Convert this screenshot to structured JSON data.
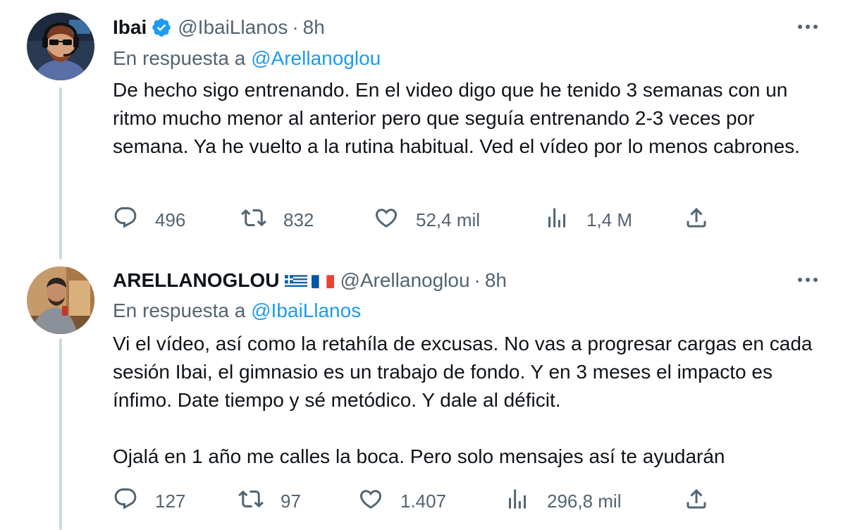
{
  "tweets": [
    {
      "display_name": "Ibai",
      "verified": true,
      "handle": "@IbaiLlanos",
      "separator": "·",
      "time": "8h",
      "reply_prefix": "En respuesta a",
      "reply_to": "@Arellanoglou",
      "text": [
        "De hecho sigo entrenando. En el video digo que he tenido 3 semanas con un ritmo mucho menor al anterior pero que seguía entrenando 2-3 veces por semana. Ya he vuelto a la rutina habitual. Ved el vídeo por lo menos cabrones."
      ],
      "stats": {
        "replies": "496",
        "retweets": "832",
        "likes": "52,4 mil",
        "views": "1,4 M"
      }
    },
    {
      "display_name": "ARELLANOGLOU",
      "flags": [
        "greece-flag",
        "france-flag"
      ],
      "handle": "@Arellanoglou",
      "separator": "·",
      "time": "8h",
      "reply_prefix": "En respuesta a",
      "reply_to": "@IbaiLlanos",
      "text": [
        "Vi el vídeo, así como la retahíla de excusas. No vas a progresar cargas en cada sesión Ibai, el gimnasio es un trabajo de fondo. Y en 3 meses el impacto es ínfimo. Date tiempo y sé metódico. Y dale al déficit.",
        "Ojalá en 1 año me calles la boca. Pero solo mensajes así te ayudarán"
      ],
      "stats": {
        "replies": "127",
        "retweets": "97",
        "likes": "1.407",
        "views": "296,8 mil"
      }
    }
  ],
  "colors": {
    "text": "#0f1419",
    "secondary": "#536471",
    "link": "#1d9bf0",
    "thread_line": "#cfd9de",
    "verified": "#1d9bf0"
  }
}
